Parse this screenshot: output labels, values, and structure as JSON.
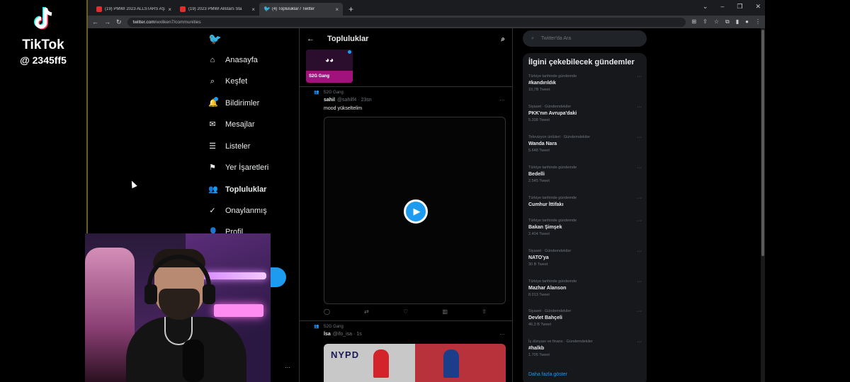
{
  "tiktok": {
    "name": "TikTok",
    "user": "@ 2345ff5"
  },
  "browser": {
    "tabs": [
      {
        "label": "(19) PMWI 2023 ALLSTARS AŞAMA",
        "close": "×"
      },
      {
        "label": "(19) 2023 PMWI Allstars Sta",
        "close": "×"
      },
      {
        "label": "(4) Topluluklar / Twitter",
        "close": "×"
      }
    ],
    "new_tab": "+",
    "url_host": "twitter.com",
    "url_path": "/wxliken7/communities",
    "win_controls": [
      "⌄",
      "–",
      "❐",
      "✕"
    ]
  },
  "nav": {
    "items": [
      {
        "label": "Anasayfa",
        "icon": "⌂"
      },
      {
        "label": "Keşfet",
        "icon": "⌕"
      },
      {
        "label": "Bildirimler",
        "icon": "🔔"
      },
      {
        "label": "Mesajlar",
        "icon": "✉"
      },
      {
        "label": "Listeler",
        "icon": "☰"
      },
      {
        "label": "Yer İşaretleri",
        "icon": "⚑"
      },
      {
        "label": "Topluluklar",
        "icon": "👥"
      },
      {
        "label": "Onaylanmış",
        "icon": "✓"
      },
      {
        "label": "Profil",
        "icon": "👤"
      }
    ]
  },
  "timeline": {
    "title": "Topluluklar",
    "back": "←",
    "community_name": "S2G Gang",
    "tweet1": {
      "community": "S2G Gang",
      "name": "sahil",
      "handle": "@sahilf4 · 23sn",
      "text": "mood yükseltelim",
      "more": "···"
    },
    "tweet2": {
      "community": "S2G Gang",
      "name": "İsa",
      "handle": "@ifo_isa · 1s",
      "more": "···",
      "meme_text": "NYPD"
    }
  },
  "right": {
    "search_placeholder": "Twitter'da Ara",
    "trends_title": "İlgini çekebilecek gündemler",
    "trends": [
      {
        "context": "Türkiye tarihinde gündemde",
        "name": "#kandırıldık",
        "count": "10,7B Tweet"
      },
      {
        "context": "Siyaset · Gündemdekiler",
        "name": "PKK'nın Avrupa'daki",
        "count": "5.338 Tweet"
      },
      {
        "context": "Televizyon ünlüleri · Gündemdekiler",
        "name": "Wanda Nara",
        "count": "5.648 Tweet"
      },
      {
        "context": "Türkiye tarihinde gündemde",
        "name": "Bedelli",
        "count": "2.545 Tweet"
      },
      {
        "context": "Türkiye tarihinde gündemde",
        "name": "Cumhur İttifakı",
        "count": ""
      },
      {
        "context": "Türkiye tarihinde gündemde",
        "name": "Bakan Şimşek",
        "count": "2.404 Tweet"
      },
      {
        "context": "Siyaset · Gündemdekiler",
        "name": "NATO'ya",
        "count": "30 B Tweet"
      },
      {
        "context": "Türkiye tarihinde gündemde",
        "name": "Mazhar Alanson",
        "count": "8.013 Tweet"
      },
      {
        "context": "Siyaset · Gündemdekiler",
        "name": "Devlet Bahçeli",
        "count": "46,3 B Tweet"
      },
      {
        "context": "İş dünyası ve finans · Gündemdekiler",
        "name": "#halkb",
        "count": "1.705 Tweet"
      }
    ],
    "show_more": "Daha fazla göster"
  }
}
